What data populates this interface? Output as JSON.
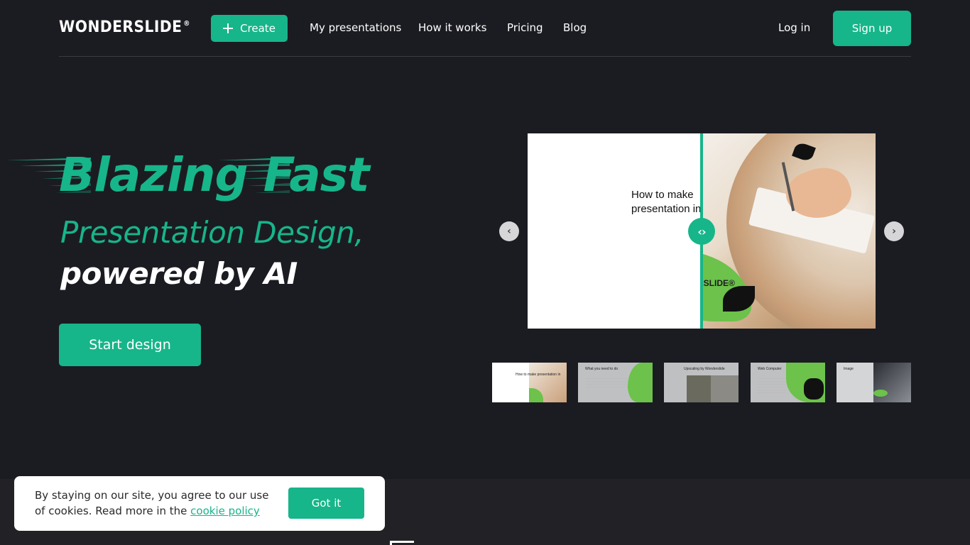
{
  "nav": {
    "logo": "WONDERSLIDE",
    "logo_mark": "®",
    "create_label": "Create",
    "links": [
      "My presentations",
      "How it works",
      "Pricing",
      "Blog"
    ],
    "login_label": "Log in",
    "signup_label": "Sign up"
  },
  "hero": {
    "title": "Blazing Fast",
    "subtitle_line1": "Presentation Design,",
    "subtitle_line2": "powered by AI",
    "cta_label": "Start design"
  },
  "preview": {
    "slide_text_line1": "How to make",
    "slide_text_line2": "presentation in",
    "brand": "WONDERSLIDE®"
  },
  "thumbnails": [
    {
      "text": "How to make presentation in"
    },
    {
      "text": "What you need to do"
    },
    {
      "text": "Upscaling by Wonderslide"
    },
    {
      "text": "Web Computer"
    },
    {
      "text": "Image"
    }
  ],
  "cookie": {
    "text_before": "By staying on our site, you agree to our use of cookies. Read more in the ",
    "link_label": "cookie policy",
    "button_label": "Got it"
  },
  "colors": {
    "accent": "#17b58a",
    "background": "#1b1c22"
  }
}
